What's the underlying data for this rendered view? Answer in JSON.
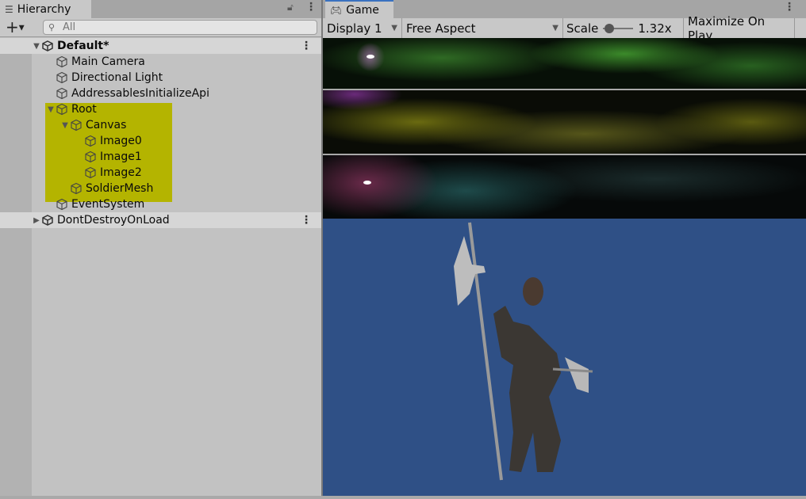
{
  "hierarchy": {
    "tab_label": "Hierarchy",
    "search_placeholder": "All",
    "items": [
      {
        "label": "Default*",
        "depth": 0,
        "type": "scene",
        "expanded": true
      },
      {
        "label": "Main Camera",
        "depth": 1
      },
      {
        "label": "Directional Light",
        "depth": 1
      },
      {
        "label": "AddressablesInitializeApi",
        "depth": 1
      },
      {
        "label": "Root",
        "depth": 1,
        "expanded": true
      },
      {
        "label": "Canvas",
        "depth": 2,
        "expanded": true
      },
      {
        "label": "Image0",
        "depth": 3
      },
      {
        "label": "Image1",
        "depth": 3
      },
      {
        "label": "Image2",
        "depth": 3
      },
      {
        "label": "SoldierMesh",
        "depth": 2
      },
      {
        "label": "EventSystem",
        "depth": 1
      },
      {
        "label": "DontDestroyOnLoad",
        "depth": 0,
        "type": "scene",
        "expanded": false
      }
    ],
    "highlight_color": "#b4b400"
  },
  "game": {
    "tab_label": "Game",
    "display": "Display 1",
    "aspect": "Free Aspect",
    "scale_label": "Scale",
    "scale_value": "1.32x",
    "maximize_label": "Maximize On Play",
    "background_color": "#2f5086"
  }
}
